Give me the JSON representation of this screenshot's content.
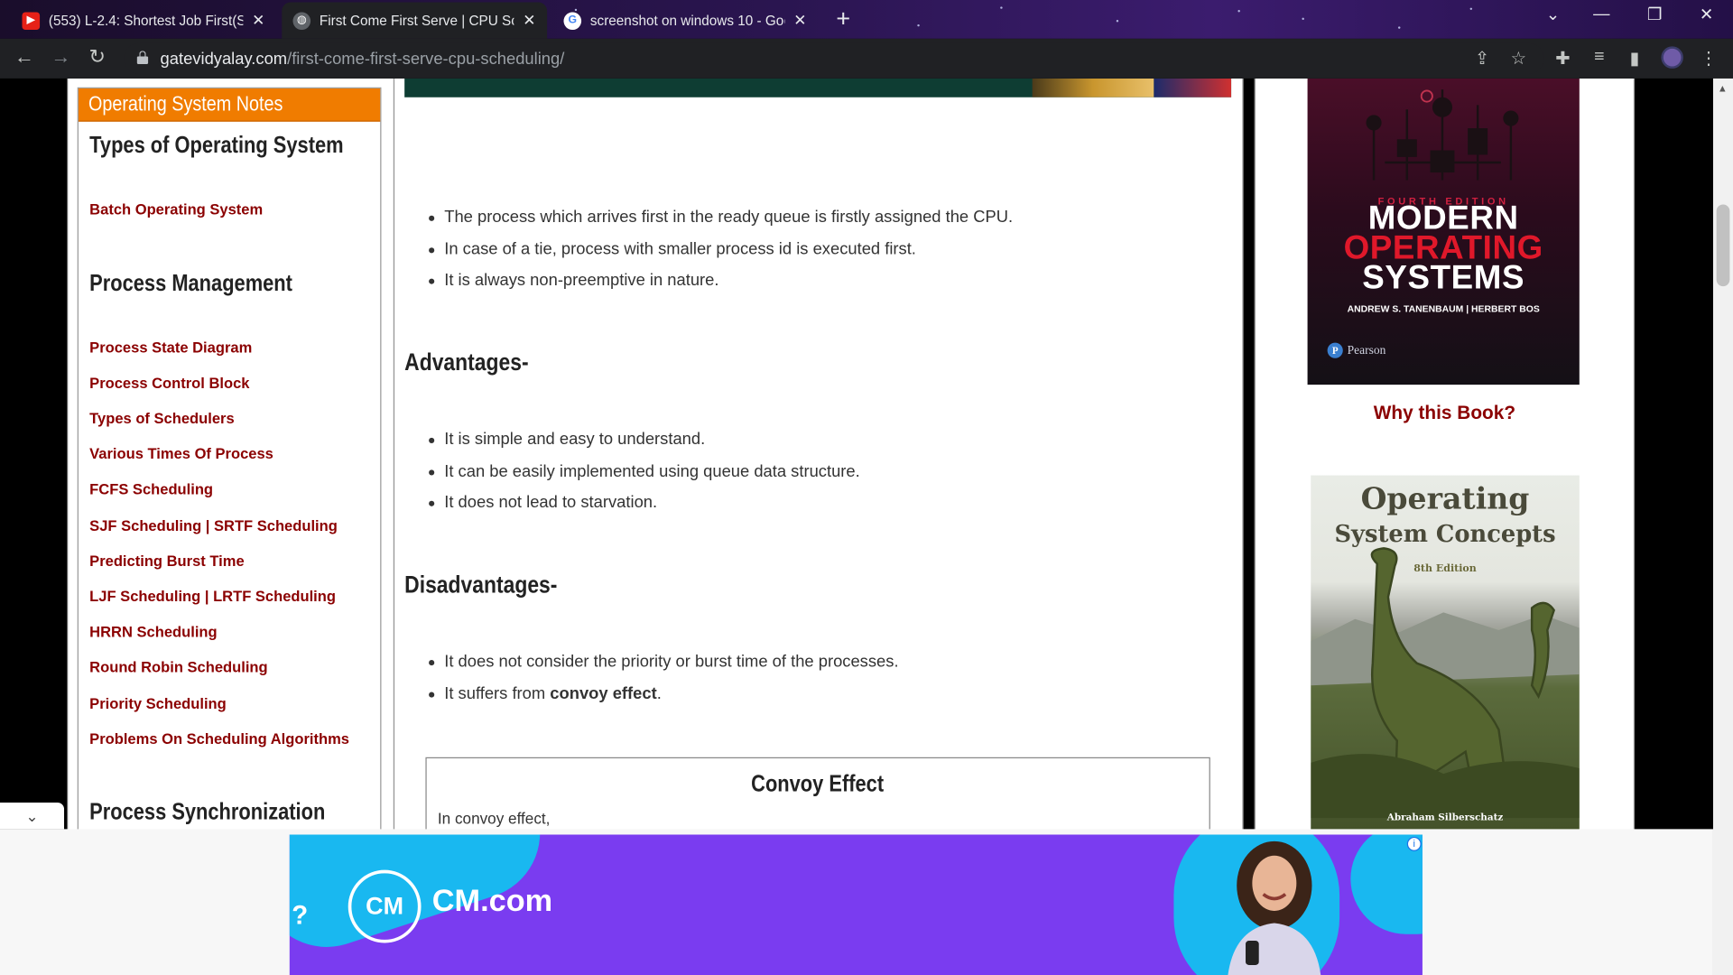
{
  "browser": {
    "tabs": [
      {
        "title": "(553) L-2.4: Shortest Job First(SJF",
        "favicon": "youtube-icon",
        "active": false
      },
      {
        "title": "First Come First Serve | CPU Sche",
        "favicon": "globe-icon",
        "active": true
      },
      {
        "title": "screenshot on windows 10 - Goo",
        "favicon": "google-icon",
        "active": false
      }
    ],
    "url_host": "gatevidyalay.com",
    "url_path": "/first-come-first-serve-cpu-scheduling/"
  },
  "sidebar": {
    "heading": "Operating System Notes",
    "sections": [
      {
        "title": "Types of Operating System",
        "links": [
          "Batch Operating System"
        ]
      },
      {
        "title": "Process Management",
        "links": [
          "Process State Diagram",
          "Process Control Block",
          "Types of Schedulers",
          "Various Times Of Process",
          "FCFS Scheduling",
          "SJF Scheduling | SRTF Scheduling",
          "Predicting Burst Time",
          "LJF Scheduling | LRTF Scheduling",
          "HRRN Scheduling",
          "Round Robin Scheduling",
          "Priority Scheduling",
          "Problems On Scheduling Algorithms"
        ]
      },
      {
        "title": "Process Synchronization",
        "links": []
      }
    ]
  },
  "article": {
    "intro_points": [
      "The process which arrives first in the ready queue is firstly assigned the CPU.",
      "In case of a tie, process with smaller process id is executed first.",
      "It is always non-preemptive in nature."
    ],
    "advantages_title": "Advantages-",
    "advantages": [
      "It is simple and easy to understand.",
      "It can be easily implemented using queue data structure.",
      "It does not lead to starvation."
    ],
    "disadvantages_title": "Disadvantages-",
    "disadvantages": [
      "It does not consider the priority or burst time of the processes."
    ],
    "convoy_point_prefix": "It suffers from ",
    "convoy_point_bold": "convoy effect",
    "convoy_point_suffix": ".",
    "convoy_box_title": "Convoy Effect",
    "convoy_box_text": "In convoy effect,"
  },
  "right_sidebar": {
    "book1": {
      "edition": "FOURTH EDITION",
      "title_lines": [
        "MODERN",
        "OPERATING",
        "SYSTEMS"
      ],
      "authors": "ANDREW S. TANENBAUM  |  HERBERT BOS",
      "publisher": "Pearson"
    },
    "why_label": "Why this Book?",
    "book2": {
      "title_lines": [
        "Operating",
        "System Concepts"
      ],
      "edition": "8th Edition",
      "authors": "Abraham Silberschatz"
    }
  },
  "ad": {
    "logo_text": "CM",
    "brand": "CM.com",
    "question_mark": "?",
    "info": "i"
  }
}
